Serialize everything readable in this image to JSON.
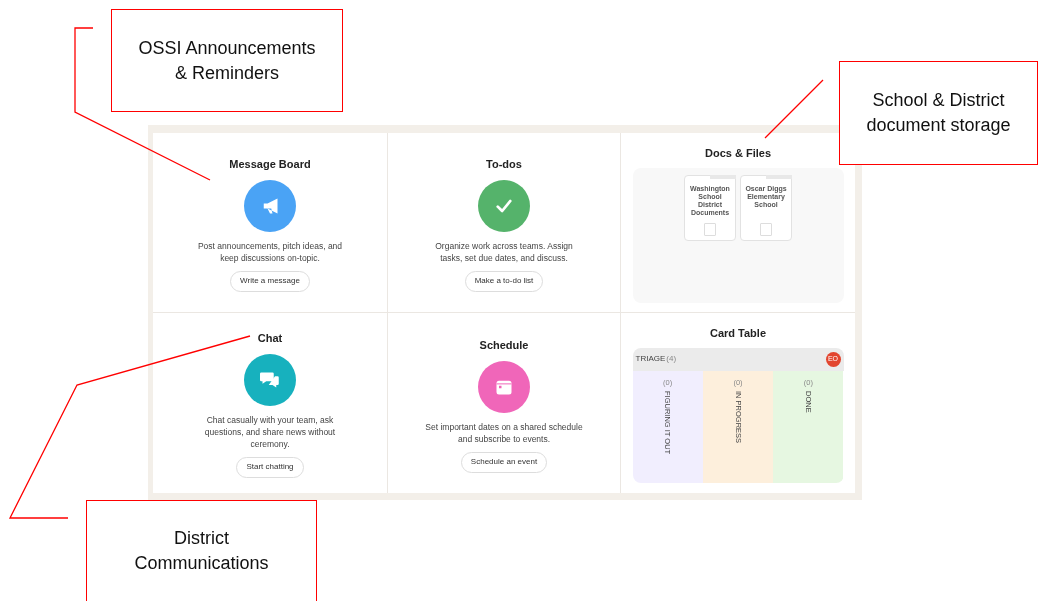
{
  "tools": [
    {
      "kind": "message_board",
      "title": "Message Board",
      "description": "Post announcements, pitch ideas, and keep discussions on-topic.",
      "button": "Write a message"
    },
    {
      "kind": "todos",
      "title": "To-dos",
      "description": "Organize work across teams. Assign tasks, set due dates, and discuss.",
      "button": "Make a to-do list"
    },
    {
      "kind": "docs",
      "title": "Docs & Files",
      "folders": [
        {
          "name": "Washington School District Documents"
        },
        {
          "name": "Oscar Diggs Elementary School"
        }
      ]
    },
    {
      "kind": "chat",
      "title": "Chat",
      "description": "Chat casually with your team, ask questions, and share news without ceremony.",
      "button": "Start chatting"
    },
    {
      "kind": "schedule",
      "title": "Schedule",
      "description": "Set important dates on a shared schedule and subscribe to events.",
      "button": "Schedule an event"
    },
    {
      "kind": "card_table",
      "title": "Card Table",
      "triage": {
        "label": "TRIAGE",
        "count": "(4)",
        "avatar": "EO"
      },
      "columns": [
        {
          "label": "FIGURING IT OUT",
          "count": "(0)",
          "color": "#f1eefe"
        },
        {
          "label": "IN PROGRESS",
          "count": "(0)",
          "color": "#fdefdc"
        },
        {
          "label": "DONE",
          "count": "(0)",
          "color": "#e6f7e1"
        }
      ]
    }
  ],
  "callouts": [
    {
      "lines": [
        "OSSI Announcements",
        "& Reminders"
      ]
    },
    {
      "lines": [
        "School & District",
        "document storage"
      ]
    },
    {
      "lines": [
        "District",
        "Communications"
      ]
    }
  ]
}
